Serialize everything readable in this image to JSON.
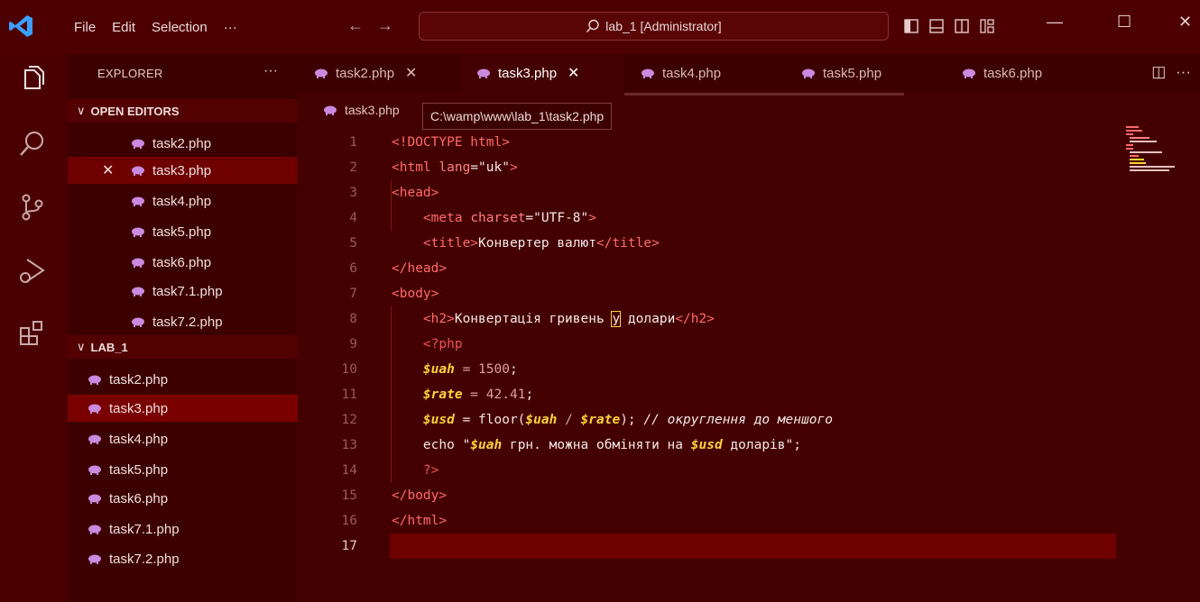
{
  "titlebar": {
    "menu": [
      "File",
      "Edit",
      "Selection",
      "···"
    ],
    "command_center": "lab_1 [Administrator]",
    "back": "←",
    "forward": "→"
  },
  "explorer": {
    "title": "EXPLORER",
    "more": "···",
    "open_editors": {
      "label": "OPEN EDITORS",
      "files": [
        "task2.php",
        "task3.php",
        "task4.php",
        "task5.php",
        "task6.php",
        "task7.1.php",
        "task7.2.php"
      ],
      "active_index": 1
    },
    "folder": {
      "label": "LAB_1",
      "files": [
        "task2.php",
        "task3.php",
        "task4.php",
        "task5.php",
        "task6.php",
        "task7.1.php",
        "task7.2.php"
      ],
      "selected_index": 1
    }
  },
  "tabs": [
    {
      "label": "task2.php",
      "close": "✕"
    },
    {
      "label": "task3.php",
      "close": "✕"
    },
    {
      "label": "task4.php"
    },
    {
      "label": "task5.php"
    },
    {
      "label": "task6.php"
    }
  ],
  "breadcrumb": "task3.php",
  "tooltip": "C:\\wamp\\www\\lab_1\\task2.php",
  "code": {
    "line_numbers": [
      "1",
      "2",
      "3",
      "4",
      "5",
      "6",
      "7",
      "8",
      "9",
      "10",
      "11",
      "12",
      "13",
      "14",
      "15",
      "16",
      "17"
    ],
    "current_line": 17,
    "l1": "<!DOCTYPE html>",
    "l2a": "<html ",
    "l2b": "lang",
    "l2c": "=",
    "l2d": "\"uk\"",
    "l2e": ">",
    "l3": "<head>",
    "l4a": "<meta ",
    "l4b": "charset",
    "l4c": "=",
    "l4d": "\"UTF-8\"",
    "l4e": ">",
    "l5a": "<title>",
    "l5b": "Конвертер валют",
    "l5c": "</title>",
    "l6": "</head>",
    "l7": "<body>",
    "l8a": "<h2>",
    "l8b": "Конвертація гривень ",
    "l8c": "у",
    "l8d": " долари",
    "l8e": "</h2>",
    "l9": "<?php",
    "l10a": "$uah",
    "l10b": " = ",
    "l10c": "1500",
    "l10d": ";",
    "l11a": "$rate",
    "l11b": " = ",
    "l11c": "42.41",
    "l11d": ";",
    "l12a": "$usd",
    "l12b": " = floor(",
    "l12c": "$uah",
    "l12d": " / ",
    "l12e": "$rate",
    "l12f": "); ",
    "l12g": "// округлення до меншого",
    "l13a": "echo \"",
    "l13b": "$uah",
    "l13c": " грн. можна обміняти на ",
    "l13d": "$usd",
    "l13e": " доларів\";",
    "l14": "?>",
    "l15": "</body>",
    "l16": "</html>"
  },
  "colors": {
    "background": "#440000",
    "accent": "#ff6a6a",
    "variable": "#ffd23a",
    "selection": "#7a0000"
  }
}
